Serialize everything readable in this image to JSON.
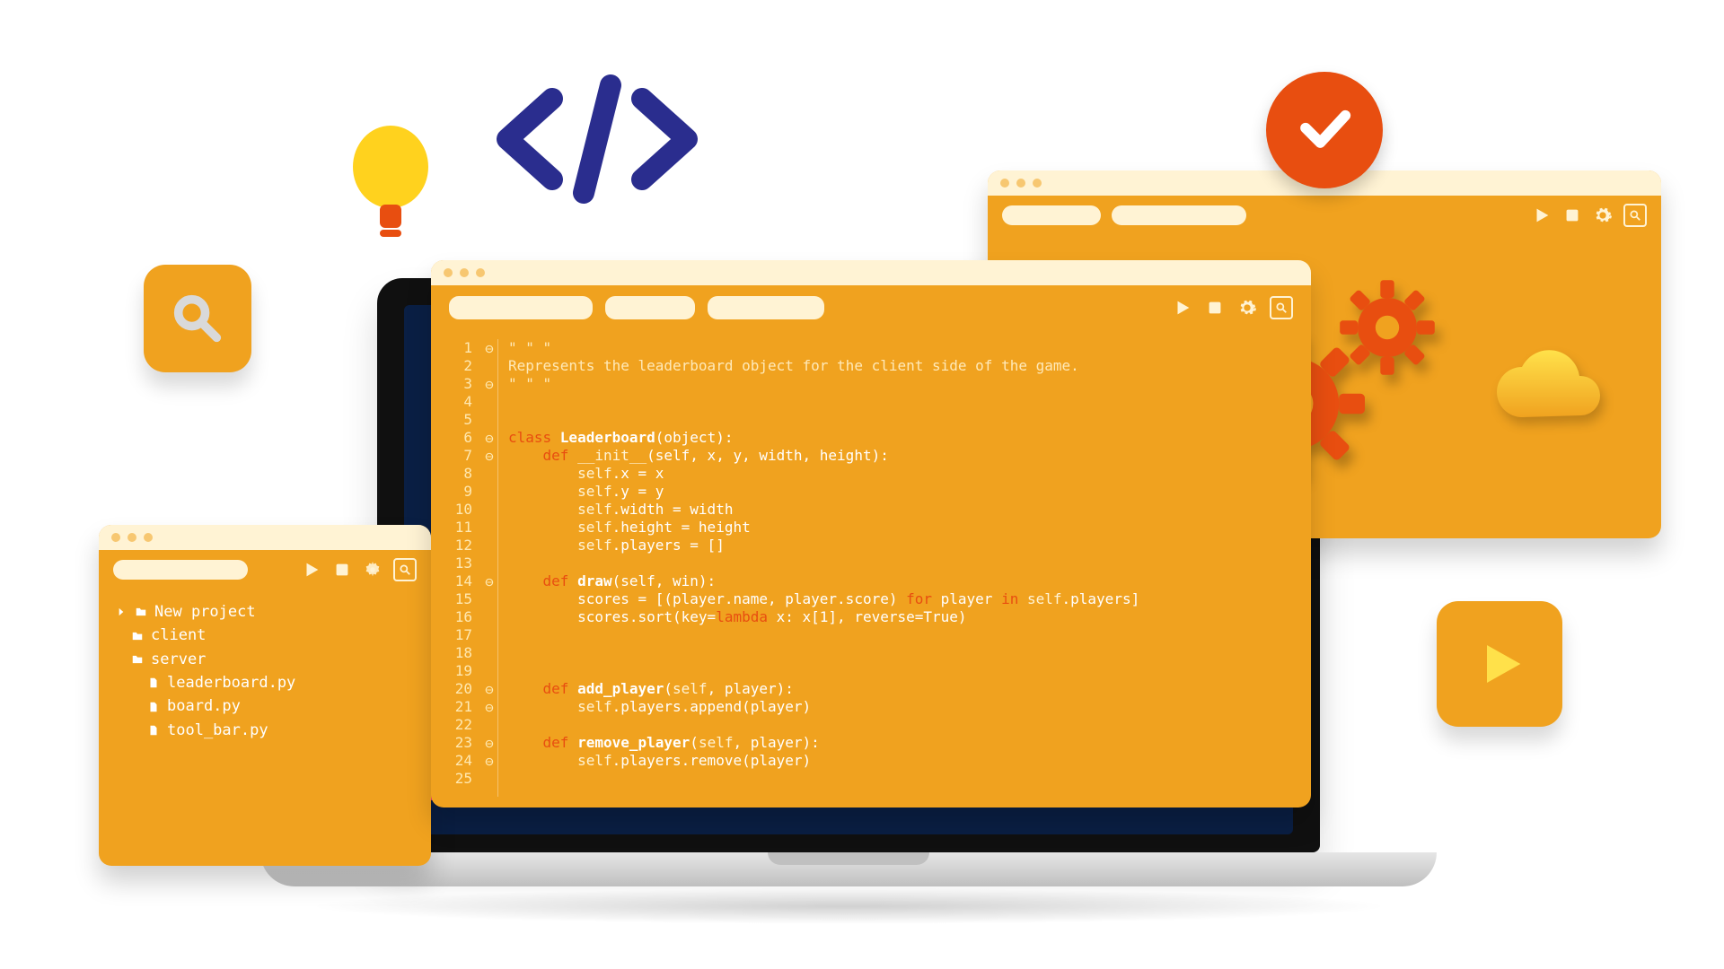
{
  "decor": {
    "bulb_icon": "lightbulb",
    "code_brackets_icon": "code-brackets",
    "check_badge_icon": "checkmark",
    "search_tile_icon": "magnifier",
    "play_tile_icon": "play"
  },
  "toolbar_icons": {
    "play": "play",
    "stop": "stop",
    "settings": "gear",
    "search": "search"
  },
  "back_window": {
    "content_icons": [
      "gear-large",
      "gear-small",
      "cloud"
    ]
  },
  "file_tree": {
    "root": "New project",
    "folders": [
      {
        "name": "client",
        "files": []
      },
      {
        "name": "server",
        "files": [
          "leaderboard.py",
          "board.py",
          "tool_bar.py"
        ]
      }
    ]
  },
  "editor": {
    "language": "python",
    "lines": [
      {
        "n": 1,
        "fold": "⊖",
        "indent": 0,
        "tokens": [
          [
            "str",
            "\" \" \""
          ]
        ]
      },
      {
        "n": 2,
        "fold": "",
        "indent": 0,
        "tokens": [
          [
            "str",
            "Represents the leaderboard object for the client side of the game."
          ]
        ]
      },
      {
        "n": 3,
        "fold": "⊖",
        "indent": 0,
        "tokens": [
          [
            "str",
            "\" \" \""
          ]
        ]
      },
      {
        "n": 4,
        "fold": "",
        "indent": 0,
        "tokens": []
      },
      {
        "n": 5,
        "fold": "",
        "indent": 0,
        "tokens": []
      },
      {
        "n": 6,
        "fold": "⊖",
        "indent": 0,
        "tokens": [
          [
            "kw",
            "class "
          ],
          [
            "hi",
            "Leaderboard"
          ],
          [
            "",
            "(object):"
          ]
        ]
      },
      {
        "n": 7,
        "fold": "⊖",
        "indent": 1,
        "tokens": [
          [
            "kw",
            "def "
          ],
          [
            "fn",
            "__init__"
          ],
          [
            "",
            "(self, x, y, width, height):"
          ]
        ]
      },
      {
        "n": 8,
        "fold": "",
        "indent": 2,
        "tokens": [
          [
            "fn",
            "self"
          ],
          [
            "",
            ".x = x"
          ]
        ]
      },
      {
        "n": 9,
        "fold": "",
        "indent": 2,
        "tokens": [
          [
            "fn",
            "self"
          ],
          [
            "",
            ".y = y"
          ]
        ]
      },
      {
        "n": 10,
        "fold": "",
        "indent": 2,
        "tokens": [
          [
            "fn",
            "self"
          ],
          [
            "",
            ".width = width"
          ]
        ]
      },
      {
        "n": 11,
        "fold": "",
        "indent": 2,
        "tokens": [
          [
            "fn",
            "self"
          ],
          [
            "",
            ".height = height"
          ]
        ]
      },
      {
        "n": 12,
        "fold": "",
        "indent": 2,
        "tokens": [
          [
            "fn",
            "self"
          ],
          [
            "",
            ".players = []"
          ]
        ]
      },
      {
        "n": 13,
        "fold": "",
        "indent": 0,
        "tokens": []
      },
      {
        "n": 14,
        "fold": "⊖",
        "indent": 1,
        "tokens": [
          [
            "kw",
            "def "
          ],
          [
            "hi",
            "draw"
          ],
          [
            "",
            "(self, win):"
          ]
        ]
      },
      {
        "n": 15,
        "fold": "",
        "indent": 2,
        "tokens": [
          [
            "",
            "scores = [(player.name, player.score) "
          ],
          [
            "kw",
            "for "
          ],
          [
            "",
            "player "
          ],
          [
            "kw",
            "in "
          ],
          [
            "fn",
            "self"
          ],
          [
            "",
            ".players]"
          ]
        ]
      },
      {
        "n": 16,
        "fold": "",
        "indent": 2,
        "tokens": [
          [
            "",
            "scores.sort(key="
          ],
          [
            "kw",
            "lambda "
          ],
          [
            "",
            "x: x[1], reverse=True)"
          ]
        ]
      },
      {
        "n": 17,
        "fold": "",
        "indent": 0,
        "tokens": []
      },
      {
        "n": 18,
        "fold": "",
        "indent": 0,
        "tokens": []
      },
      {
        "n": 19,
        "fold": "",
        "indent": 0,
        "tokens": []
      },
      {
        "n": 20,
        "fold": "⊖",
        "indent": 1,
        "tokens": [
          [
            "kw",
            "def "
          ],
          [
            "hi",
            "add_player"
          ],
          [
            "",
            "("
          ],
          [
            "fn",
            "self"
          ],
          [
            "",
            ", player):"
          ]
        ]
      },
      {
        "n": 21,
        "fold": "⊖",
        "indent": 2,
        "tokens": [
          [
            "fn",
            "self"
          ],
          [
            "",
            ".players.append(player)"
          ]
        ]
      },
      {
        "n": 22,
        "fold": "",
        "indent": 0,
        "tokens": []
      },
      {
        "n": 23,
        "fold": "⊖",
        "indent": 1,
        "tokens": [
          [
            "kw",
            "def "
          ],
          [
            "hi",
            "remove_player"
          ],
          [
            "",
            "("
          ],
          [
            "fn",
            "self"
          ],
          [
            "",
            ", player):"
          ]
        ]
      },
      {
        "n": 24,
        "fold": "⊖",
        "indent": 2,
        "tokens": [
          [
            "fn",
            "self"
          ],
          [
            "",
            ".players.remove(player)"
          ]
        ]
      },
      {
        "n": 25,
        "fold": "",
        "indent": 0,
        "tokens": []
      }
    ]
  }
}
